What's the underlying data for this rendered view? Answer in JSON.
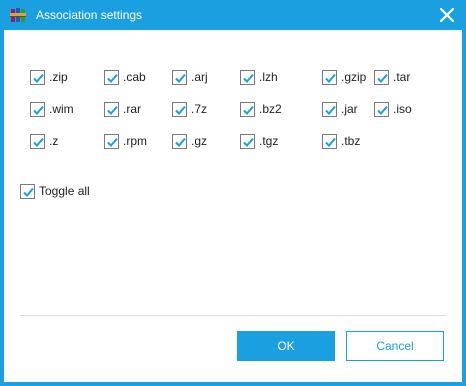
{
  "window": {
    "title": "Association settings",
    "accent_color": "#1a9fe0"
  },
  "extensions": [
    {
      "label": ".zip",
      "checked": true
    },
    {
      "label": ".cab",
      "checked": true
    },
    {
      "label": ".arj",
      "checked": true
    },
    {
      "label": ".lzh",
      "checked": true
    },
    {
      "label": ".gzip",
      "checked": true
    },
    {
      "label": ".tar",
      "checked": true
    },
    {
      "label": ".wim",
      "checked": true
    },
    {
      "label": ".rar",
      "checked": true
    },
    {
      "label": ".7z",
      "checked": true
    },
    {
      "label": ".bz2",
      "checked": true
    },
    {
      "label": ".jar",
      "checked": true
    },
    {
      "label": ".iso",
      "checked": true
    },
    {
      "label": ".z",
      "checked": true
    },
    {
      "label": ".rpm",
      "checked": true
    },
    {
      "label": ".gz",
      "checked": true
    },
    {
      "label": ".tgz",
      "checked": true
    },
    {
      "label": ".tbz",
      "checked": true
    }
  ],
  "toggle_all": {
    "label": "Toggle all",
    "checked": true
  },
  "buttons": {
    "ok": "OK",
    "cancel": "Cancel"
  },
  "icons": {
    "app": "winrar-books-icon",
    "close": "close-icon",
    "check": "checkmark-icon"
  }
}
